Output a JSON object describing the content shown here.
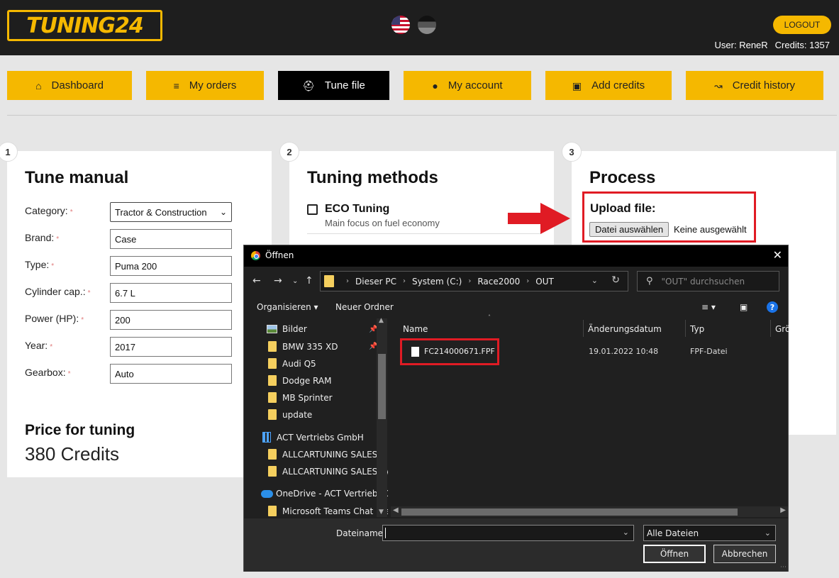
{
  "header": {
    "logo_text": "TUNING24",
    "logout_label": "LOGOUT",
    "user_text": "User: ReneR",
    "credits_text": "Credits: 1357"
  },
  "nav": [
    {
      "label": "Dashboard",
      "icon": "home-icon"
    },
    {
      "label": "My orders",
      "icon": "layers-icon"
    },
    {
      "label": "Tune file",
      "icon": "car-icon"
    },
    {
      "label": "My account",
      "icon": "user-icon"
    },
    {
      "label": "Add credits",
      "icon": "cart-icon"
    },
    {
      "label": "Credit history",
      "icon": "chart-icon"
    }
  ],
  "steps": [
    "1",
    "2",
    "3"
  ],
  "tune_manual": {
    "title": "Tune manual",
    "required_mark": "*",
    "fields": [
      {
        "label": "Category:",
        "value": "Tractor & Construction"
      },
      {
        "label": "Brand:",
        "value": "Case"
      },
      {
        "label": "Type:",
        "value": "Puma 200"
      },
      {
        "label": "Cylinder cap.:",
        "value": "6.7 L"
      },
      {
        "label": "Power (HP):",
        "value": "200"
      },
      {
        "label": "Year:",
        "value": "2017"
      },
      {
        "label": "Gearbox:",
        "value": "Auto"
      }
    ],
    "price_title": "Price for tuning",
    "price_value": "380 Credits"
  },
  "tuning_methods": {
    "title": "Tuning methods",
    "methods": [
      {
        "name": "ECO Tuning",
        "desc": "Main focus on fuel economy"
      }
    ]
  },
  "process": {
    "title": "Process",
    "upload_title": "Upload file:",
    "file_button": "Datei auswählen",
    "file_none": "Keine ausgewählt"
  },
  "dialog": {
    "title": "Öffnen",
    "breadcrumbs": [
      "Dieser PC",
      "System (C:)",
      "Race2000",
      "OUT"
    ],
    "search_placeholder": "\"OUT\" durchsuchen",
    "organize_label": "Organisieren ▾",
    "new_folder_label": "Neuer Ordner",
    "tree": [
      {
        "label": "Bilder",
        "icon": "image-icon",
        "pinned": true
      },
      {
        "label": "BMW 335 XD",
        "icon": "folder-icon",
        "pinned": true
      },
      {
        "label": "Audi Q5",
        "icon": "folder-icon"
      },
      {
        "label": "Dodge RAM",
        "icon": "folder-icon"
      },
      {
        "label": "MB Sprinter",
        "icon": "folder-icon"
      },
      {
        "label": "update",
        "icon": "folder-icon"
      },
      {
        "label": "ACT Vertriebs GmbH",
        "icon": "building-icon"
      },
      {
        "label": "ALLCARTUNING SALES - ",
        "icon": "folder-icon"
      },
      {
        "label": "ALLCARTUNING SALES - \\",
        "icon": "folder-icon"
      },
      {
        "label": "OneDrive - ACT Vertriebs G",
        "icon": "cloud-icon"
      },
      {
        "label": "Microsoft Teams Chat File",
        "icon": "folder-icon"
      }
    ],
    "columns": [
      "Name",
      "Änderungsdatum",
      "Typ",
      "Grö"
    ],
    "file": {
      "name": "FC214000671.FPF",
      "date": "19.01.2022 10:48",
      "type": "FPF-Datei"
    },
    "filename_label": "Dateiname:",
    "filename_value": "",
    "filetype_value": "Alle Dateien",
    "open_label": "Öffnen",
    "cancel_label": "Abbrechen"
  },
  "colors": {
    "brand_yellow": "#f5b800",
    "highlight_red": "#e01b24",
    "header_bg": "#1e1e1e",
    "dialog_bg": "#202020"
  }
}
